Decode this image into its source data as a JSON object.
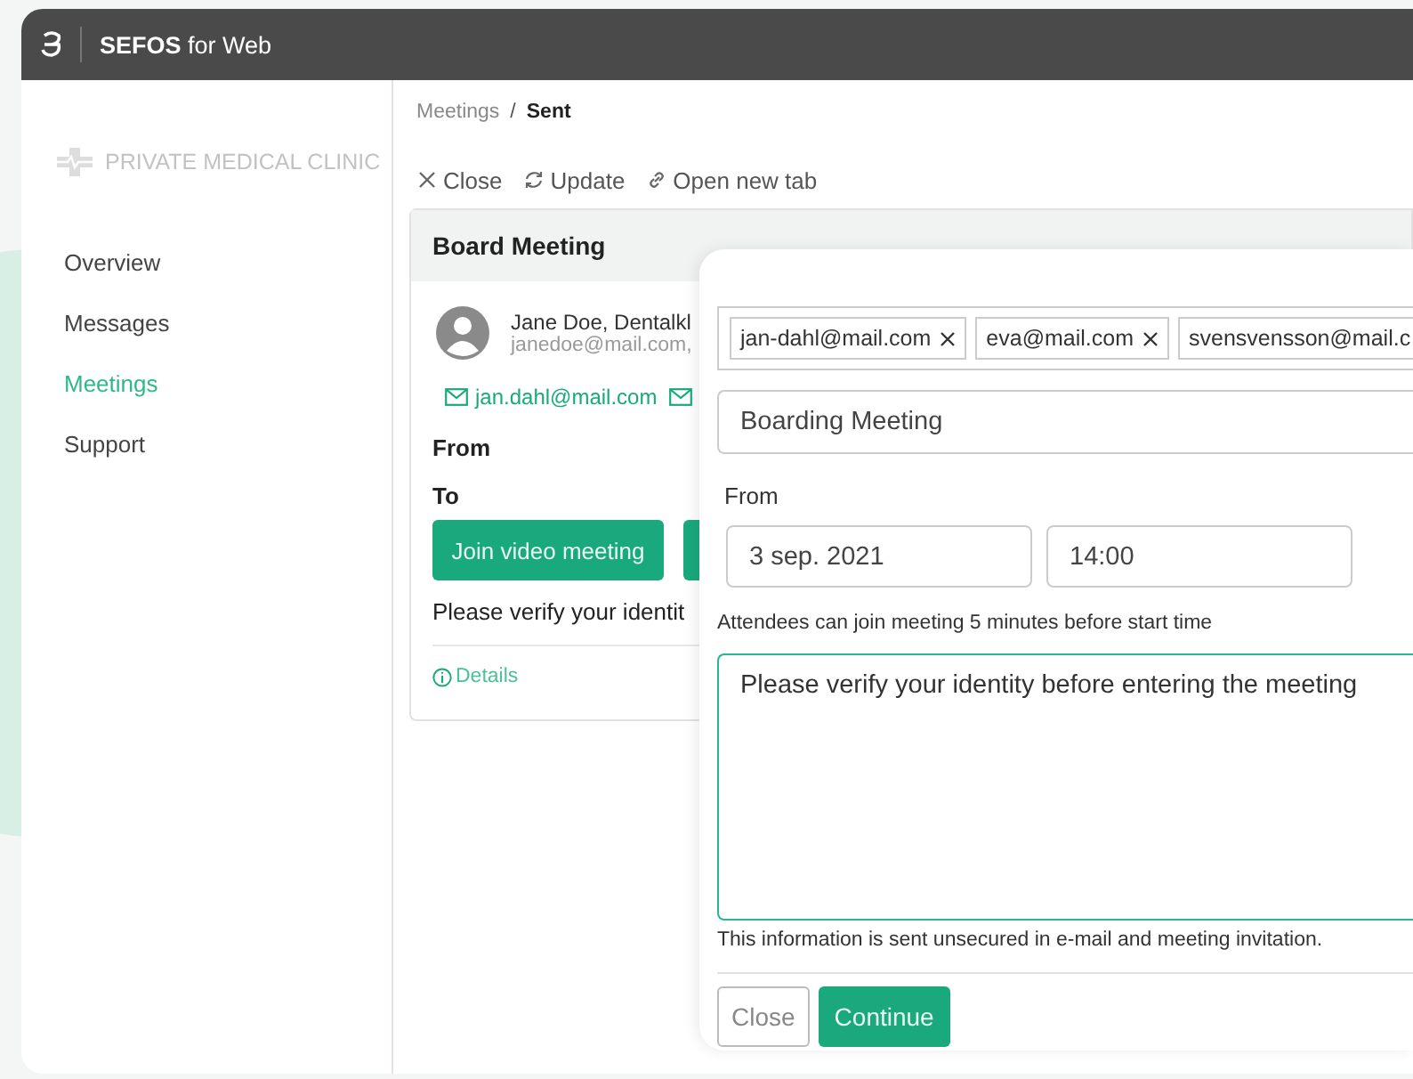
{
  "window": {
    "brand": "SEFOS",
    "title": "for Web"
  },
  "sidebar": {
    "clinic": "PRIVATE MEDICAL CLINIC",
    "items": [
      {
        "label": "Overview",
        "selected": false
      },
      {
        "label": "Messages",
        "selected": false
      },
      {
        "label": "Meetings",
        "selected": true
      },
      {
        "label": "Support",
        "selected": false
      }
    ]
  },
  "breadcrumb": {
    "parent": "Meetings",
    "separator": "/",
    "current": "Sent"
  },
  "toolbar": [
    {
      "kind": "close",
      "label": "Close"
    },
    {
      "kind": "update",
      "label": "Update"
    },
    {
      "kind": "link",
      "label": "Open new tab"
    }
  ],
  "card": {
    "title": "Board Meeting",
    "sender_name": "Jane Doe, Dentalkl",
    "sender_email": "janedoe@mail.com,",
    "recipient": "jan.dahl@mail.com",
    "from_label": "From",
    "to_label": "To",
    "join_button": "Join video meeting",
    "message": "Please verify your identit",
    "details": "Details"
  },
  "modal": {
    "tags": [
      {
        "label": "jan-dahl@mail.com",
        "removable": true
      },
      {
        "label": "eva@mail.com",
        "removable": true
      },
      {
        "label": "svensvensson@mail.c",
        "removable": false
      }
    ],
    "subject": "Boarding Meeting",
    "from_label": "From",
    "date": "3 sep. 2021",
    "time": "14:00",
    "hint": "Attendees can join meeting 5 minutes before start time",
    "message": "Please verify your identity before entering the meeting",
    "note": "This information is sent unsecured in e-mail and meeting invitation.",
    "buttons": [
      {
        "kind": "secondary",
        "label": "Close"
      },
      {
        "kind": "primary",
        "label": "Continue"
      }
    ]
  }
}
